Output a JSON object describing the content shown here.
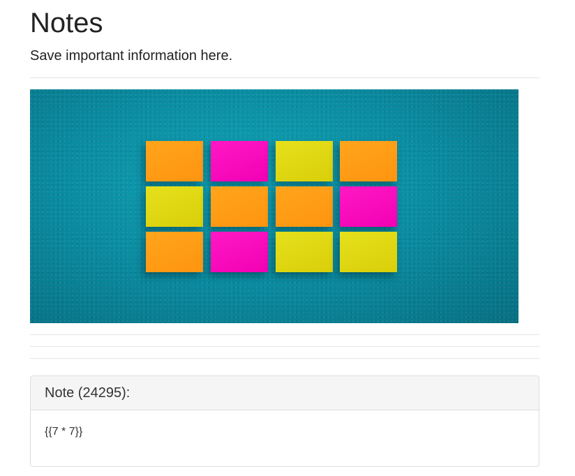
{
  "header": {
    "title": "Notes",
    "subtitle": "Save important information here."
  },
  "hero_image": {
    "description_icon": "sticky-notes-image",
    "colors": {
      "wall": "#0b8ea3",
      "orange": "#ff9a14",
      "pink": "#f80cbc",
      "yellow": "#dfd612"
    },
    "grid": [
      [
        "orange",
        "pink",
        "yellow",
        "orange"
      ],
      [
        "yellow",
        "orange",
        "orange",
        "pink"
      ],
      [
        "orange",
        "pink",
        "yellow",
        "yellow"
      ]
    ]
  },
  "note": {
    "header": "Note (24295):",
    "body": "{{7 * 7}}"
  }
}
